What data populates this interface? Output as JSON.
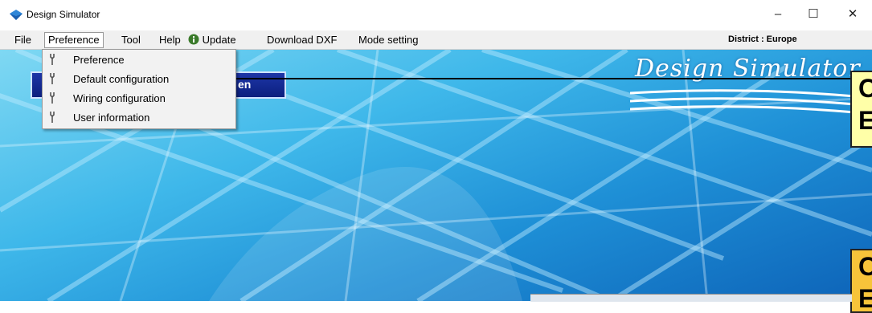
{
  "window": {
    "title": "Design Simulator",
    "minimize": "–",
    "maximize": "☐",
    "close": "✕"
  },
  "menubar": {
    "items": [
      {
        "label": "File"
      },
      {
        "label": "Preference"
      },
      {
        "label": "Tool"
      },
      {
        "label": "Help"
      },
      {
        "label": "Update"
      },
      {
        "label": "Download DXF"
      },
      {
        "label": "Mode setting"
      }
    ],
    "district": "District : Europe"
  },
  "dropdown": {
    "items": [
      {
        "label": "Preference",
        "icon": "wrench-icon"
      },
      {
        "label": "Default configuration",
        "icon": "wrench-icon"
      },
      {
        "label": "Wiring configuration",
        "icon": "wrench-icon"
      },
      {
        "label": "User information",
        "icon": "wrench-icon"
      }
    ]
  },
  "content": {
    "button_text": "en",
    "brand": "Design Simulator",
    "callout_top": "C\nE",
    "callout_bottom": "C\nE"
  },
  "colors": {
    "callout_top_bg": "#ffffa8",
    "callout_bottom_bg": "#f7c43a",
    "button_bg": "#0b1f7e"
  }
}
